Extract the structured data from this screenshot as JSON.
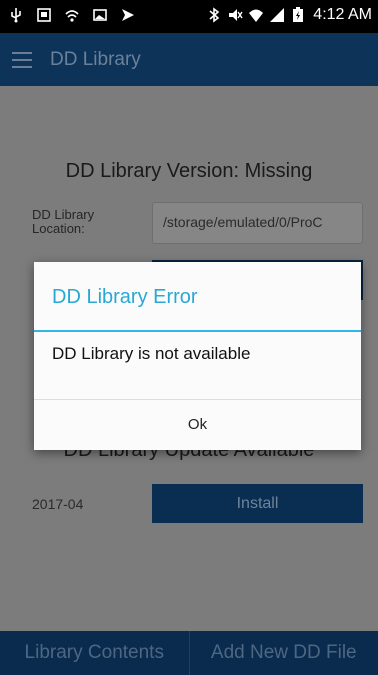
{
  "status_bar": {
    "time": "4:12 AM",
    "left_icons": [
      "usb-icon",
      "image-icon",
      "wifi-icon",
      "gallery-icon",
      "send-icon"
    ],
    "right_icons": [
      "bluetooth-icon",
      "mute-icon",
      "wifi-signal-icon",
      "cell-signal-icon",
      "battery-charging-icon"
    ]
  },
  "app_bar": {
    "title": "DD Library",
    "menu_icon": "hamburger-menu-icon"
  },
  "content": {
    "version_title": "DD Library Version: Missing",
    "location_label": "DD Library Location:",
    "location_value": "/storage/emulated/0/ProC",
    "update_title": "DD Library Update Available",
    "update_date": "2017-04",
    "install_label": "Install"
  },
  "bottom_bar": {
    "tabs": [
      {
        "label": "Library Contents"
      },
      {
        "label": "Add New DD File"
      }
    ]
  },
  "dialog": {
    "title": "DD Library Error",
    "message": "DD Library is not available",
    "ok_label": "Ok"
  },
  "colors": {
    "accent": "#33b5e5",
    "app_bar": "#0e3358",
    "dim_overlay": "#7c7c7c"
  }
}
